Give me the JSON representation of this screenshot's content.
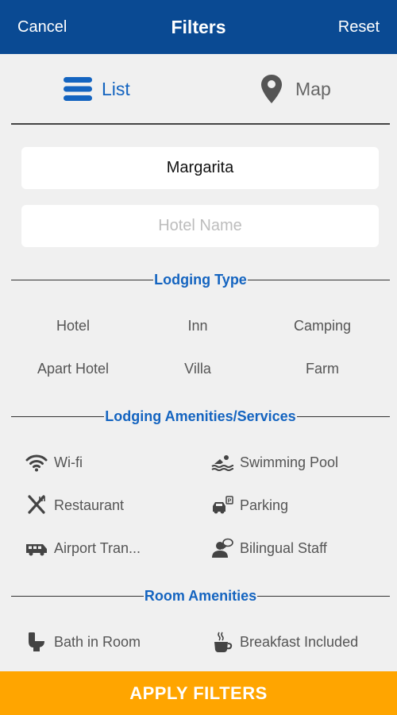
{
  "header": {
    "cancel_label": "Cancel",
    "title": "Filters",
    "reset_label": "Reset",
    "bg_color": "#0a4a93"
  },
  "view_toggle": {
    "list": {
      "label": "List",
      "icon": "list-icon",
      "active": true
    },
    "map": {
      "label": "Map",
      "icon": "map-pin-icon",
      "active": false
    }
  },
  "search": {
    "city_value": "Margarita",
    "hotel_placeholder": "Hotel Name"
  },
  "lodging_type": {
    "title": "Lodging Type",
    "options": [
      "Hotel",
      "Inn",
      "Camping",
      "Apart Hotel",
      "Villa",
      "Farm"
    ]
  },
  "lodging_amenities": {
    "title": "Lodging Amenities/Services",
    "items": [
      {
        "label": "Wi-fi",
        "icon": "wifi-icon"
      },
      {
        "label": "Swimming Pool",
        "icon": "swimming-pool-icon"
      },
      {
        "label": "Restaurant",
        "icon": "restaurant-icon"
      },
      {
        "label": "Parking",
        "icon": "parking-icon"
      },
      {
        "label": "Airport Tran...",
        "icon": "airport-shuttle-icon"
      },
      {
        "label": "Bilingual Staff",
        "icon": "bilingual-staff-icon"
      }
    ]
  },
  "room_amenities": {
    "title": "Room Amenities",
    "items": [
      {
        "label": "Bath in Room",
        "icon": "toilet-icon"
      },
      {
        "label": "Breakfast Included",
        "icon": "coffee-cup-icon"
      }
    ]
  },
  "apply_label": "APPLY FILTERS",
  "colors": {
    "accent": "#1464c0",
    "apply": "#ffa500",
    "background": "#f0f0f0"
  }
}
